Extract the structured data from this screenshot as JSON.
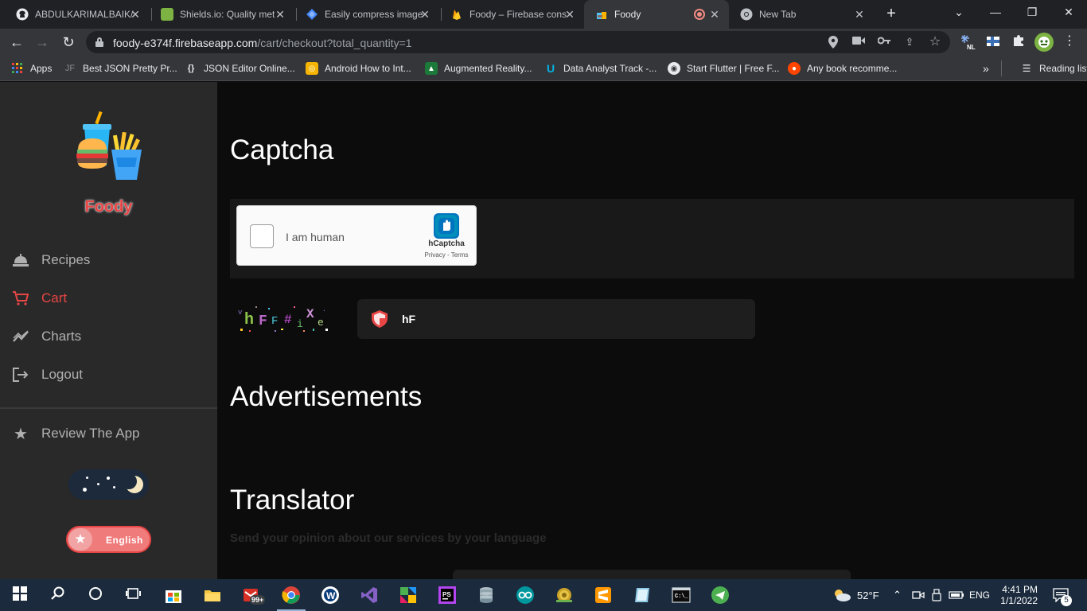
{
  "browser": {
    "tabs": [
      {
        "title": "ABDULKARIMALBAIK/",
        "favicon": "github-icon",
        "active": false
      },
      {
        "title": "Shields.io: Quality met",
        "favicon": "shields-icon",
        "active": false
      },
      {
        "title": "Easily compress image",
        "favicon": "compress-icon",
        "active": false
      },
      {
        "title": "Foody – Firebase cons",
        "favicon": "firebase-icon",
        "active": false
      },
      {
        "title": "Foody",
        "favicon": "foody-icon",
        "active": true
      },
      {
        "title": "New Tab",
        "favicon": "chrome-icon",
        "active": false
      }
    ],
    "url_host": "foody-e374f.firebaseapp.com",
    "url_path": "/cart/checkout?total_quantity=1",
    "bookmarks": [
      {
        "label": "Apps",
        "icon": "apps-grid-icon"
      },
      {
        "label": "Best JSON Pretty Pr...",
        "icon": "jf-icon"
      },
      {
        "label": "JSON Editor Online...",
        "icon": "json-editor-icon"
      },
      {
        "label": "Android How to Int...",
        "icon": "android-icon"
      },
      {
        "label": "Augmented Reality...",
        "icon": "ar-icon"
      },
      {
        "label": "Data Analyst Track -...",
        "icon": "udacity-icon"
      },
      {
        "label": "Start Flutter | Free F...",
        "icon": "globe-icon"
      },
      {
        "label": "Any book recomme...",
        "icon": "reddit-icon"
      }
    ],
    "bookmarks_overflow": "»",
    "reading_list": "Reading list"
  },
  "sidebar": {
    "brand": "Foody",
    "items": [
      {
        "label": "Recipes",
        "icon": "recipes-icon",
        "active": false
      },
      {
        "label": "Cart",
        "icon": "cart-icon",
        "active": true
      },
      {
        "label": "Charts",
        "icon": "chart-line-icon",
        "active": false
      },
      {
        "label": "Logout",
        "icon": "logout-icon",
        "active": false
      }
    ],
    "review": {
      "label": "Review The App",
      "icon": "star-icon"
    },
    "language": "English"
  },
  "main": {
    "captcha_heading": "Captcha",
    "hcaptcha": {
      "checkbox_label": "I am human",
      "brand": "hCaptcha",
      "links": "Privacy - Terms"
    },
    "captcha_image_text": "hF#X",
    "captcha_value": "hF",
    "ads_heading": "Advertisements",
    "translator_heading": "Translator",
    "translator_subtext": "Send your opinion about our services by your language"
  },
  "taskbar": {
    "weather": "52°F",
    "lang": "ENG",
    "time": "4:41 PM",
    "date": "1/1/2022",
    "notification_count": "5",
    "badge": "99+"
  },
  "colors": {
    "accent": "#e84545",
    "sidebar_bg": "#292929",
    "main_bg": "#0c0c0c"
  }
}
